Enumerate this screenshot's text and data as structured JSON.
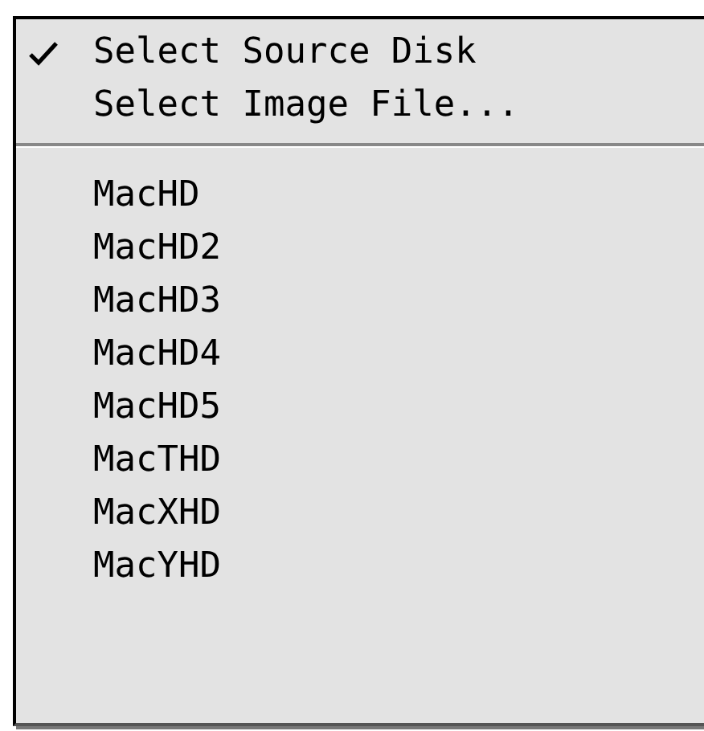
{
  "menu": {
    "sections": [
      {
        "items": [
          {
            "label": "Select Source Disk",
            "checked": true
          },
          {
            "label": "Select Image File...",
            "checked": false
          }
        ]
      },
      {
        "items": [
          {
            "label": "MacHD",
            "checked": false
          },
          {
            "label": "MacHD2",
            "checked": false
          },
          {
            "label": "MacHD3",
            "checked": false
          },
          {
            "label": "MacHD4",
            "checked": false
          },
          {
            "label": "MacHD5",
            "checked": false
          },
          {
            "label": "MacTHD",
            "checked": false
          },
          {
            "label": "MacXHD",
            "checked": false
          },
          {
            "label": "MacYHD",
            "checked": false
          }
        ]
      }
    ]
  }
}
